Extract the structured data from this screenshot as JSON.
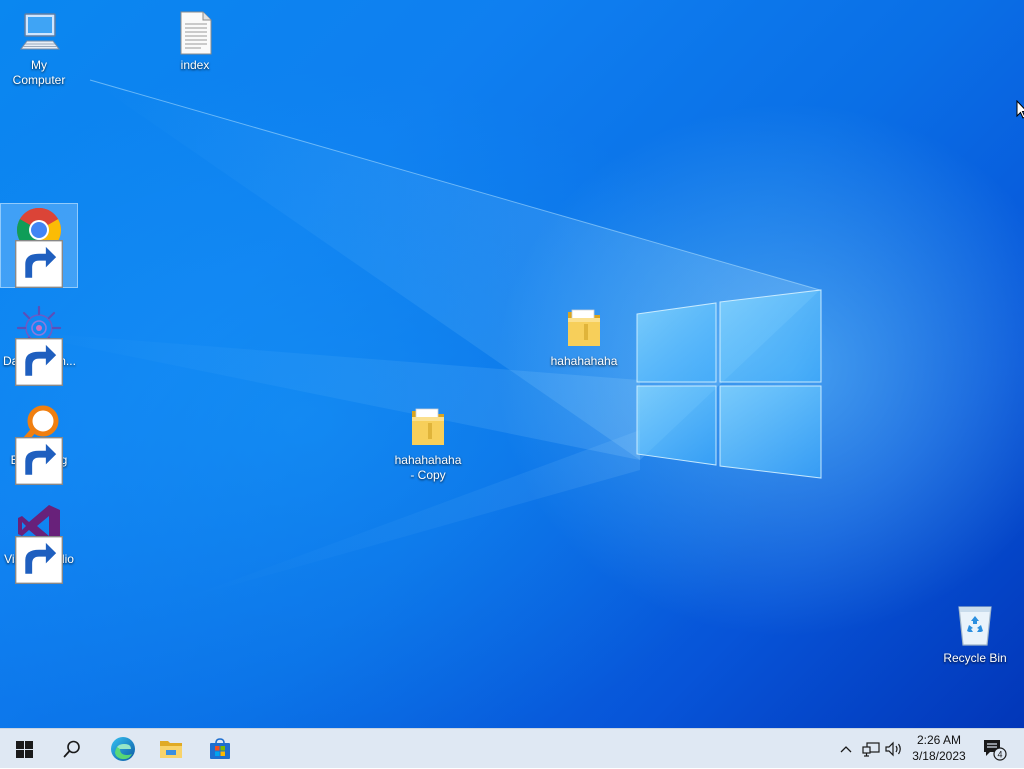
{
  "desktop": {
    "icons": {
      "my_computer": {
        "label": "My Computer"
      },
      "index": {
        "label": "index"
      },
      "chrome": {
        "label": "Google Chrome"
      },
      "datawagon": {
        "label": "DataWagon..."
      },
      "everything": {
        "label": "Everything"
      },
      "visual_studio": {
        "label": "Visual Studio 2015"
      },
      "folder1": {
        "label": "hahahahaha"
      },
      "folder2": {
        "label": "hahahahaha - Copy"
      },
      "recycle_bin": {
        "label": "Recycle Bin"
      }
    }
  },
  "taskbar": {
    "start_icon": "windows-start-icon",
    "search_icon": "search-icon",
    "pinned": [
      "edge-icon",
      "file-explorer-icon",
      "store-icon"
    ],
    "tray": {
      "clock_time": "2:26 AM",
      "clock_date": "3/18/2023",
      "notification_count": "4"
    }
  },
  "colors": {
    "desktop_blue": "#0a6fe6",
    "taskbar": "#dfe8f3"
  }
}
